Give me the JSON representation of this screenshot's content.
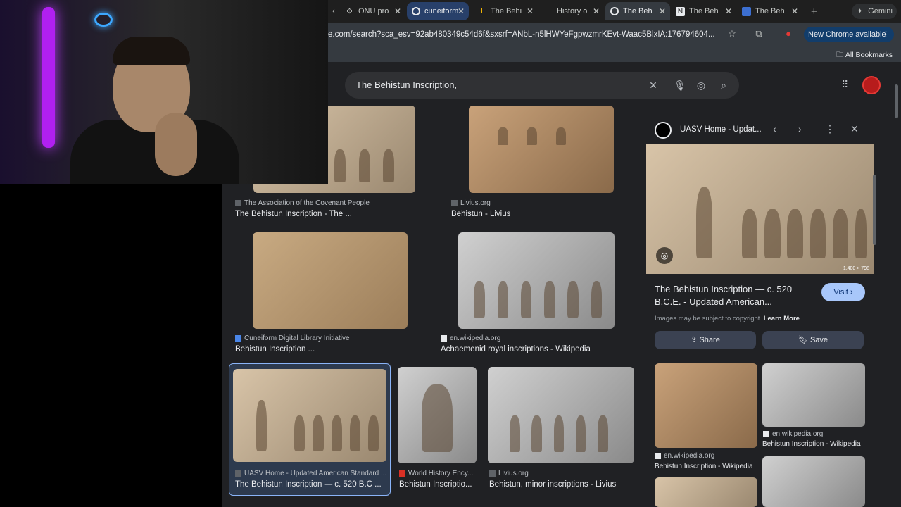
{
  "tabs": [
    {
      "label": "ONU pro",
      "icon": "gear-icon"
    },
    {
      "label": "cuneiform",
      "icon": "google-icon"
    },
    {
      "label": "The Behi",
      "icon": "document-icon"
    },
    {
      "label": "History o",
      "icon": "document-icon"
    },
    {
      "label": "The Beh",
      "icon": "google-icon"
    },
    {
      "label": "The Beh",
      "icon": "notion-icon"
    },
    {
      "label": "The Beh",
      "icon": "image-icon"
    }
  ],
  "gemini_label": "Gemini",
  "url": "e.com/search?sca_esv=92ab480349c54d6f&sxsrf=ANbL-n5lHWYeFgpwzmrKEvt-Waac5BlxIA:176794604...",
  "new_chrome_label": "New Chrome available",
  "bookmarks_label": "All Bookmarks",
  "search_query": "The Behistun Inscription,",
  "results": [
    {
      "source": "The Association of the Covenant People",
      "title": "The Behistun Inscription - The ..."
    },
    {
      "source": "Livius.org",
      "title": "Behistun - Livius"
    },
    {
      "source": "Cuneiform Digital Library Initiative",
      "title": "Behistun Inscription ..."
    },
    {
      "source": "en.wikipedia.org",
      "title": "Achaemenid royal inscriptions - Wikipedia"
    },
    {
      "source": "UASV Home - Updated American Standard ...",
      "title": "The Behistun Inscription — c. 520 B.C ..."
    },
    {
      "source": "World History Ency...",
      "title": "Behistun Inscriptio..."
    },
    {
      "source": "Livius.org",
      "title": "Behistun, minor inscriptions - Livius"
    }
  ],
  "panel": {
    "site": "UASV Home - Updat...",
    "image_size": "1,400 × 798",
    "title": "The Behistun Inscription — c. 520 B.C.E. - Updated American...",
    "visit_label": "Visit",
    "copyright": "Images may be subject to copyright.",
    "learn_more": "Learn More",
    "share_label": "Share",
    "save_label": "Save",
    "related": [
      {
        "source": "en.wikipedia.org",
        "title": "Behistun Inscription - Wikipedia"
      },
      {
        "source": "en.wikipedia.org",
        "title": "Behistun Inscription - Wikipedia"
      }
    ]
  }
}
